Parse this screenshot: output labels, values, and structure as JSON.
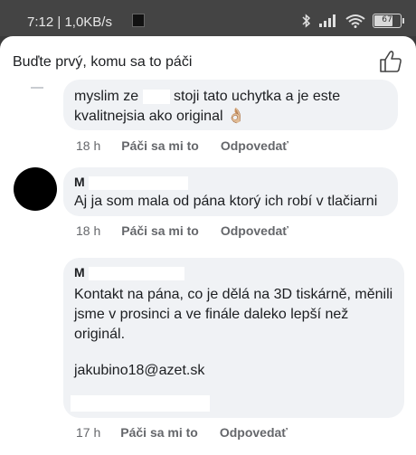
{
  "status_bar": {
    "time": "7:12",
    "network_speed": "1,0KB/s",
    "battery_level": "67",
    "icons": [
      "stop-icon",
      "bluetooth-icon",
      "signal-icon",
      "wifi-icon",
      "battery-icon"
    ]
  },
  "header": {
    "title": "Buďte prvý, komu sa to páči",
    "like_icon": "thumbs-up-icon"
  },
  "comments": [
    {
      "text_before": "myslim ze",
      "text_after": "stoji tato uchytka a je este kvalitnejsia ako original 👌🏼",
      "time": "18 h",
      "like_label": "Páči sa mi to",
      "reply_label": "Odpovedať"
    },
    {
      "name": "M",
      "text": "Aj ja som mala od pána ktorý ich robí v tlačiarni",
      "time": "18 h",
      "like_label": "Páči sa mi to",
      "reply_label": "Odpovedať"
    },
    {
      "name": "M",
      "text": "Kontakt na pána, co je dělá na 3D tiskárně, měnili jsme v prosinci a ve finále daleko lepší než originál.",
      "email": "jakubino18@azet.sk",
      "time": "17 h",
      "like_label": "Páči sa mi to",
      "reply_label": "Odpovedať"
    }
  ],
  "colors": {
    "bubble_bg": "#f0f2f5",
    "meta_text": "#65676b",
    "status_bar_bg": "#444444"
  }
}
